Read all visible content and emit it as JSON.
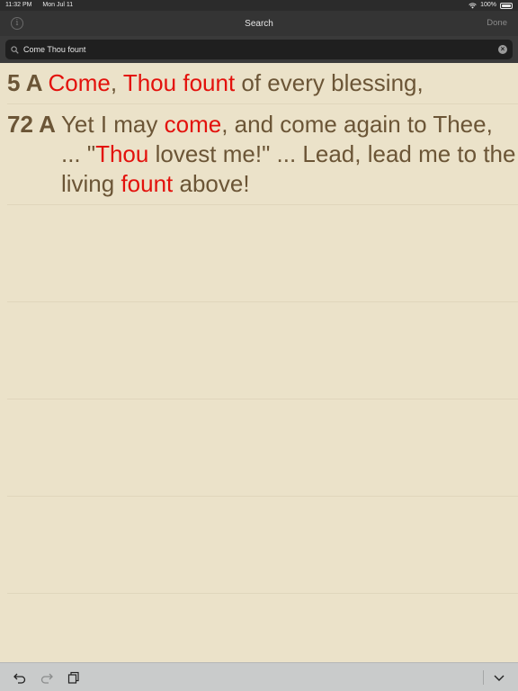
{
  "status": {
    "time": "11:32 PM",
    "date": "Mon Jul 11",
    "battery": "100%"
  },
  "nav": {
    "info_label": "i",
    "title": "Search",
    "done_label": "Done"
  },
  "search": {
    "value": "Come Thou fount",
    "clear_label": "×"
  },
  "results": [
    {
      "ref": "5 A",
      "segments": [
        {
          "text": "Come",
          "hl": true
        },
        {
          "text": ", ",
          "hl": false
        },
        {
          "text": "Thou",
          "hl": true
        },
        {
          "text": " ",
          "hl": false
        },
        {
          "text": "fount",
          "hl": true
        },
        {
          "text": " of every blessing,",
          "hl": false
        }
      ]
    },
    {
      "ref": "72 A",
      "segments": [
        {
          "text": "Yet I may ",
          "hl": false
        },
        {
          "text": "come",
          "hl": true
        },
        {
          "text": ", and come again to Thee, ... \"",
          "hl": false
        },
        {
          "text": "Thou",
          "hl": true
        },
        {
          "text": " lovest me!\" ... Lead, lead me to the living ",
          "hl": false
        },
        {
          "text": "fount",
          "hl": true
        },
        {
          "text": " above!",
          "hl": false
        }
      ]
    }
  ],
  "empty_rows": 5,
  "colors": {
    "background": "#ebe2c9",
    "text": "#6b5536",
    "highlight": "#e3110c"
  },
  "icons": {
    "toolbar": [
      "undo-icon",
      "redo-icon",
      "copy-icon"
    ],
    "toolbar_right": "chevron-down-icon"
  }
}
